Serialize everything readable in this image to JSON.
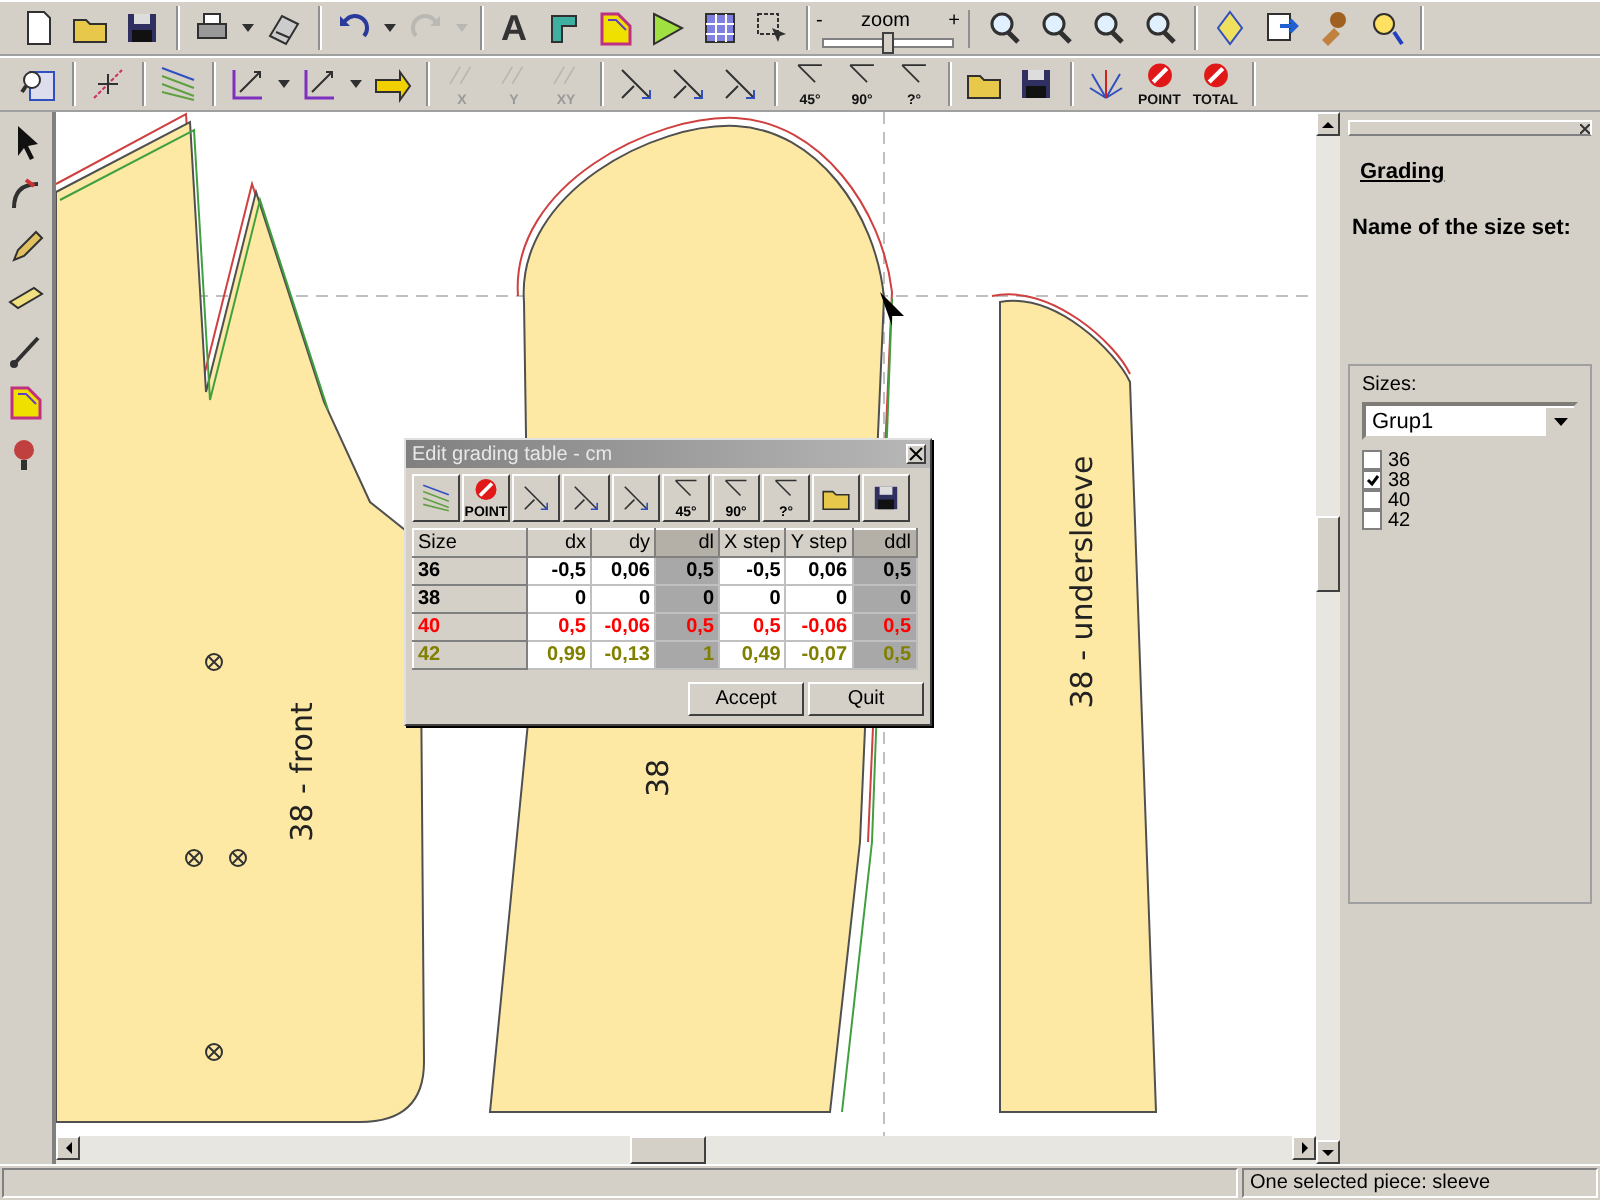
{
  "toolbar_top": {
    "groups": [
      [
        {
          "kind": "button",
          "disabled": false
        },
        {
          "kind": "button",
          "disabled": false
        },
        {
          "kind": "button",
          "disabled": false
        }
      ],
      [
        {
          "kind": "button",
          "disabled": false
        },
        {
          "kind": "caret",
          "disabled": false
        },
        {
          "kind": "button",
          "disabled": false
        }
      ],
      [
        {
          "kind": "button",
          "disabled": false
        },
        {
          "kind": "caret",
          "disabled": false
        },
        {
          "kind": "button",
          "disabled": true
        },
        {
          "kind": "caret",
          "disabled": true
        }
      ],
      [
        {
          "kind": "letter",
          "label": "A",
          "disabled": false
        },
        {
          "kind": "button",
          "disabled": false
        },
        {
          "kind": "button",
          "disabled": false
        },
        {
          "kind": "button",
          "disabled": false
        },
        {
          "kind": "button",
          "disabled": false
        },
        {
          "kind": "button",
          "disabled": false
        }
      ]
    ],
    "zoom": {
      "label": "zoom",
      "minus": "-",
      "plus": "+",
      "level": 0.5
    },
    "groups_after": [
      [
        {
          "kind": "button",
          "disabled": false
        },
        {
          "kind": "button",
          "disabled": false
        },
        {
          "kind": "button",
          "disabled": false
        },
        {
          "kind": "button",
          "disabled": false
        }
      ],
      [
        {
          "kind": "button",
          "disabled": false
        },
        {
          "kind": "button",
          "disabled": false
        },
        {
          "kind": "button",
          "disabled": false
        },
        {
          "kind": "button",
          "disabled": false
        }
      ]
    ]
  },
  "toolbar_bottom": {
    "groups": [
      [
        {
          "kind": "button",
          "disabled": false
        }
      ],
      [
        {
          "kind": "button",
          "disabled": false
        }
      ],
      [
        {
          "kind": "button",
          "disabled": false
        }
      ],
      [
        {
          "kind": "button",
          "disabled": false
        },
        {
          "kind": "caret",
          "disabled": false
        },
        {
          "kind": "button",
          "disabled": false
        },
        {
          "kind": "caret",
          "disabled": false
        },
        {
          "kind": "button",
          "disabled": false
        }
      ],
      [
        {
          "kind": "button",
          "label": "X",
          "disabled": true
        },
        {
          "kind": "button",
          "label": "Y",
          "disabled": true
        },
        {
          "kind": "button",
          "label": "XY",
          "disabled": true
        }
      ],
      [
        {
          "kind": "button",
          "disabled": false
        },
        {
          "kind": "button",
          "disabled": false
        },
        {
          "kind": "button",
          "disabled": false
        }
      ],
      [
        {
          "kind": "button",
          "label": "45°",
          "disabled": false
        },
        {
          "kind": "button",
          "label": "90°",
          "disabled": false
        },
        {
          "kind": "button",
          "label": "?°",
          "disabled": false
        }
      ],
      [
        {
          "kind": "button",
          "disabled": false
        },
        {
          "kind": "button",
          "disabled": false
        }
      ],
      [
        {
          "kind": "button",
          "disabled": false
        },
        {
          "kind": "button",
          "label": "POINT",
          "disabled": false
        },
        {
          "kind": "button",
          "label": "TOTAL",
          "disabled": false
        }
      ]
    ]
  },
  "canvas": {
    "pieces": [
      {
        "label": "38 - front"
      },
      {
        "label": "38"
      },
      {
        "label": "38 - undersleeve"
      }
    ]
  },
  "grading_dialog": {
    "title": "Edit grading table - cm",
    "toolbar": [
      {
        "kind": "button"
      },
      {
        "kind": "button",
        "label": "POINT"
      },
      {
        "kind": "button"
      },
      {
        "kind": "button"
      },
      {
        "kind": "button"
      },
      {
        "kind": "button",
        "label": "45°"
      },
      {
        "kind": "button",
        "label": "90°"
      },
      {
        "kind": "button",
        "label": "?°"
      },
      {
        "kind": "button"
      },
      {
        "kind": "button"
      }
    ],
    "columns": [
      {
        "label": "Size",
        "shaded": false
      },
      {
        "label": "dx",
        "shaded": false
      },
      {
        "label": "dy",
        "shaded": false
      },
      {
        "label": "dl",
        "shaded": true
      },
      {
        "label": "X step",
        "shaded": false
      },
      {
        "label": "Y step",
        "shaded": false
      },
      {
        "label": "ddl",
        "shaded": true
      }
    ],
    "rows": [
      {
        "size": "36",
        "color": "#000000",
        "values": [
          "-0,5",
          "0,06",
          "0,5",
          "-0,5",
          "0,06",
          "0,5"
        ]
      },
      {
        "size": "38",
        "color": "#000000",
        "values": [
          "0",
          "0",
          "0",
          "0",
          "0",
          "0"
        ]
      },
      {
        "size": "40",
        "color": "#ff0000",
        "values": [
          "0,5",
          "-0,06",
          "0,5",
          "0,5",
          "-0,06",
          "0,5"
        ]
      },
      {
        "size": "42",
        "color": "#808000",
        "values": [
          "0,99",
          "-0,13",
          "1",
          "0,49",
          "-0,07",
          "0,5"
        ]
      }
    ],
    "buttons": [
      "Accept",
      "Quit"
    ]
  },
  "side_panel": {
    "title": "Grading",
    "size_set_label": "Name of the size set:",
    "sizes_group": "Sizes:",
    "size_set": "Grup1",
    "sizes": [
      {
        "label": "36",
        "checked": false
      },
      {
        "label": "38",
        "checked": true
      },
      {
        "label": "40",
        "checked": false
      },
      {
        "label": "42",
        "checked": false
      }
    ]
  },
  "status_bar": {
    "message": "One selected piece: sleeve"
  }
}
